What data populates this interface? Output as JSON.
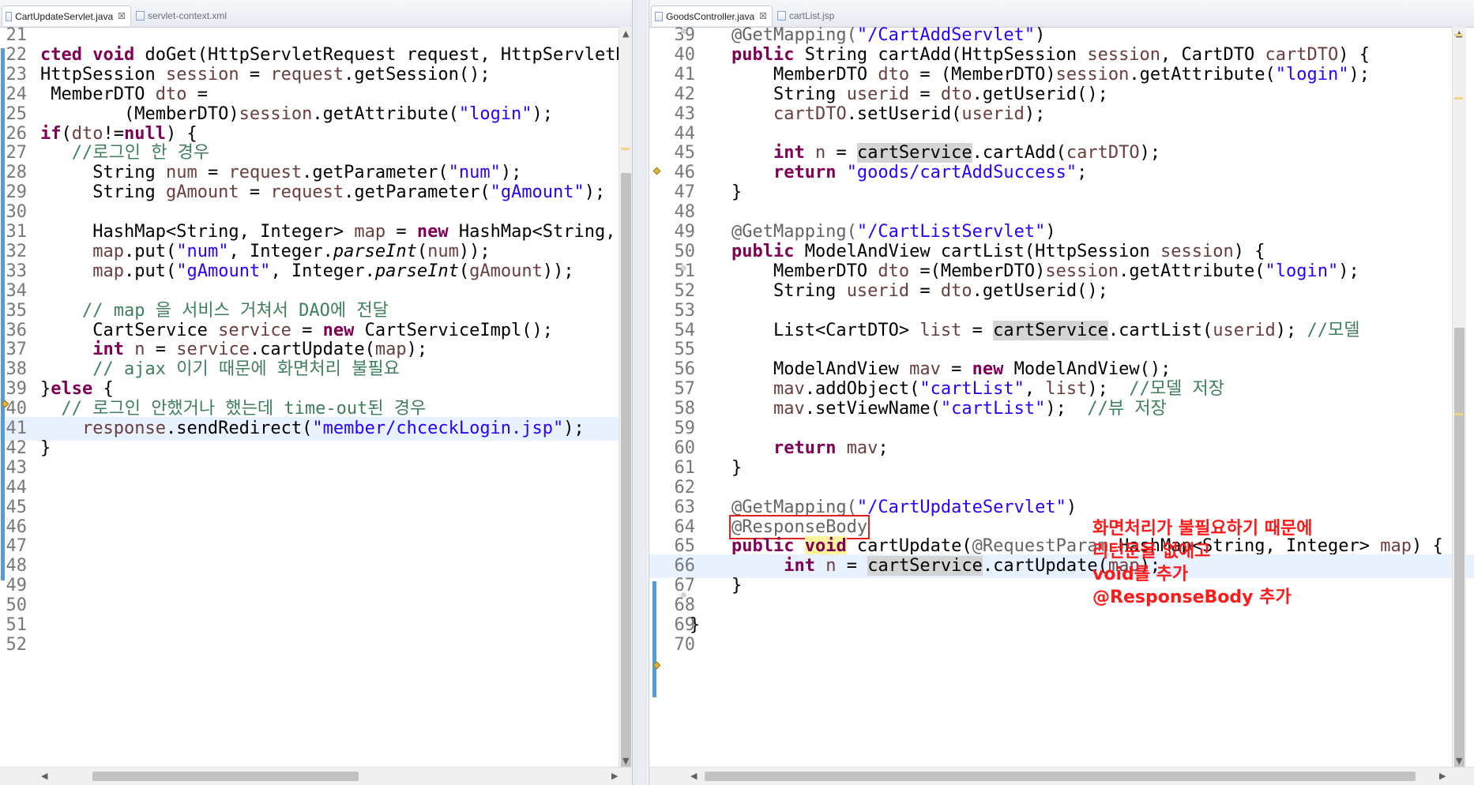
{
  "left_tabs": [
    {
      "label": "CartUpdateServlet.java",
      "active": true,
      "close": "☒"
    },
    {
      "label": "servlet-context.xml",
      "active": false
    }
  ],
  "right_tabs": [
    {
      "label": "GoodsController.java",
      "active": true,
      "close": "☒"
    },
    {
      "label": "cartList.jsp",
      "active": false
    }
  ],
  "left_lines": [
    {
      "n": "21",
      "t": []
    },
    {
      "n": "22",
      "t": [
        [
          "cted ",
          "kw"
        ],
        [
          "void ",
          "kw"
        ],
        [
          "doGet(HttpServletRequest ",
          ""
        ],
        [
          "request",
          ""
        ],
        [
          ", HttpServletRes",
          ""
        ]
      ]
    },
    {
      "n": "23",
      "t": [
        [
          "HttpSession ",
          ""
        ],
        [
          "session",
          "var"
        ],
        [
          " = ",
          ""
        ],
        [
          "request",
          "var"
        ],
        [
          ".getSession();",
          ""
        ]
      ]
    },
    {
      "n": "24",
      "t": [
        [
          " MemberDTO ",
          ""
        ],
        [
          "dto",
          "var"
        ],
        [
          " =",
          ""
        ]
      ]
    },
    {
      "n": "25",
      "t": [
        [
          "        (MemberDTO)",
          ""
        ],
        [
          "session",
          "var"
        ],
        [
          ".getAttribute(",
          ""
        ],
        [
          "\"login\"",
          "str"
        ],
        [
          ");",
          ""
        ]
      ]
    },
    {
      "n": "26",
      "t": [
        [
          "if",
          "kw"
        ],
        [
          "(",
          ""
        ],
        [
          "dto",
          "var"
        ],
        [
          "!=",
          ""
        ],
        [
          "null",
          "kw"
        ],
        [
          ") {",
          ""
        ]
      ]
    },
    {
      "n": "27",
      "t": [
        [
          "   //로그인 한 경우",
          "cm"
        ]
      ]
    },
    {
      "n": "28",
      "t": [
        [
          "     String ",
          ""
        ],
        [
          "num",
          "var"
        ],
        [
          " = ",
          ""
        ],
        [
          "request",
          "var"
        ],
        [
          ".getParameter(",
          ""
        ],
        [
          "\"num\"",
          "str"
        ],
        [
          ");",
          ""
        ]
      ]
    },
    {
      "n": "29",
      "t": [
        [
          "     String ",
          ""
        ],
        [
          "gAmount",
          "var"
        ],
        [
          " = ",
          ""
        ],
        [
          "request",
          "var"
        ],
        [
          ".getParameter(",
          ""
        ],
        [
          "\"gAmount\"",
          "str"
        ],
        [
          ");",
          ""
        ]
      ]
    },
    {
      "n": "30",
      "t": []
    },
    {
      "n": "31",
      "t": [
        [
          "     HashMap<String, Integer> ",
          ""
        ],
        [
          "map",
          "var"
        ],
        [
          " = ",
          ""
        ],
        [
          "new ",
          "kw"
        ],
        [
          "HashMap<String, In",
          ""
        ]
      ]
    },
    {
      "n": "32",
      "t": [
        [
          "     ",
          ""
        ],
        [
          "map",
          "var"
        ],
        [
          ".put(",
          ""
        ],
        [
          "\"num\"",
          "str"
        ],
        [
          ", Integer.",
          ""
        ],
        [
          "parseInt",
          "it"
        ],
        [
          "(",
          ""
        ],
        [
          "num",
          "var"
        ],
        [
          "));",
          ""
        ]
      ]
    },
    {
      "n": "33",
      "t": [
        [
          "     ",
          ""
        ],
        [
          "map",
          "var"
        ],
        [
          ".put(",
          ""
        ],
        [
          "\"gAmount\"",
          "str"
        ],
        [
          ", Integer.",
          ""
        ],
        [
          "parseInt",
          "it"
        ],
        [
          "(",
          ""
        ],
        [
          "gAmount",
          "var"
        ],
        [
          "));",
          ""
        ]
      ]
    },
    {
      "n": "34",
      "t": []
    },
    {
      "n": "35",
      "t": [
        [
          "    // map 을 서비스 거쳐서 DAO에 전달",
          "cm"
        ]
      ]
    },
    {
      "n": "36",
      "t": [
        [
          "     CartService ",
          ""
        ],
        [
          "service",
          "var"
        ],
        [
          " = ",
          ""
        ],
        [
          "new ",
          "kw"
        ],
        [
          "CartServiceImpl();",
          ""
        ]
      ]
    },
    {
      "n": "37",
      "t": [
        [
          "     ",
          ""
        ],
        [
          "int ",
          "kw"
        ],
        [
          "n",
          "var"
        ],
        [
          " = ",
          ""
        ],
        [
          "service",
          "var"
        ],
        [
          ".cartUpdate(",
          ""
        ],
        [
          "map",
          "var"
        ],
        [
          ");",
          ""
        ]
      ]
    },
    {
      "n": "38",
      "t": [
        [
          "     // ",
          "cm"
        ],
        [
          "ajax",
          "cm"
        ],
        [
          " 이기 때문에 화면처리 불필요",
          "cm"
        ]
      ]
    },
    {
      "n": "39",
      "t": [
        [
          "}",
          ""
        ],
        [
          "else",
          "kw"
        ],
        [
          " {",
          ""
        ]
      ]
    },
    {
      "n": "40",
      "t": [
        [
          "  // 로그인 안했거나 했는데 time-out된 경우",
          "cm"
        ]
      ]
    },
    {
      "n": "41",
      "t": [
        [
          "    ",
          ""
        ],
        [
          "response",
          "var"
        ],
        [
          ".sendRedirect(",
          ""
        ],
        [
          "\"member/chceckLogin.jsp\"",
          "str"
        ],
        [
          ");",
          ""
        ]
      ]
    },
    {
      "n": "42",
      "t": [
        [
          "}",
          ""
        ]
      ]
    },
    {
      "n": "43",
      "t": []
    },
    {
      "n": "44",
      "t": []
    },
    {
      "n": "45",
      "t": []
    },
    {
      "n": "46",
      "t": []
    },
    {
      "n": "47",
      "t": []
    },
    {
      "n": "48",
      "t": []
    },
    {
      "n": "49",
      "t": []
    },
    {
      "n": "50",
      "t": []
    },
    {
      "n": "51",
      "t": []
    },
    {
      "n": "52",
      "t": []
    }
  ],
  "right_lines": [
    {
      "n": "39",
      "t": [
        [
          "    @GetMapping(",
          "ann"
        ],
        [
          "\"/CartAddServlet\"",
          "str"
        ],
        [
          ")",
          ""
        ]
      ]
    },
    {
      "n": "40",
      "t": [
        [
          "    ",
          ""
        ],
        [
          "public ",
          "kw"
        ],
        [
          "String cartAdd(HttpSession ",
          ""
        ],
        [
          "session",
          "var"
        ],
        [
          ", CartDTO ",
          ""
        ],
        [
          "cartDTO",
          "var"
        ],
        [
          ") {",
          ""
        ]
      ]
    },
    {
      "n": "41",
      "t": [
        [
          "        MemberDTO ",
          ""
        ],
        [
          "dto",
          "var"
        ],
        [
          " = (MemberDTO)",
          ""
        ],
        [
          "session",
          "var"
        ],
        [
          ".getAttribute(",
          ""
        ],
        [
          "\"login\"",
          "str"
        ],
        [
          ");",
          ""
        ]
      ]
    },
    {
      "n": "42",
      "t": [
        [
          "        String ",
          ""
        ],
        [
          "userid",
          "var"
        ],
        [
          " = ",
          ""
        ],
        [
          "dto",
          "var"
        ],
        [
          ".getUserid();",
          ""
        ]
      ]
    },
    {
      "n": "43",
      "t": [
        [
          "        ",
          ""
        ],
        [
          "cartDTO",
          "var"
        ],
        [
          ".setUserid(",
          ""
        ],
        [
          "userid",
          "var"
        ],
        [
          ");",
          ""
        ]
      ]
    },
    {
      "n": "44",
      "t": []
    },
    {
      "n": "45",
      "t": [
        [
          "        ",
          ""
        ],
        [
          "int ",
          "kw"
        ],
        [
          "n",
          "var"
        ],
        [
          " = ",
          ""
        ],
        [
          "cartService",
          "occ"
        ],
        [
          ".cartAdd(",
          ""
        ],
        [
          "cartDTO",
          "var"
        ],
        [
          ");",
          ""
        ]
      ]
    },
    {
      "n": "46",
      "t": [
        [
          "        ",
          ""
        ],
        [
          "return ",
          "kw"
        ],
        [
          "\"goods/cartAddSuccess\"",
          "str"
        ],
        [
          ";",
          ""
        ]
      ]
    },
    {
      "n": "47",
      "t": [
        [
          "    }",
          ""
        ]
      ]
    },
    {
      "n": "48",
      "t": []
    },
    {
      "n": "49",
      "t": [
        [
          "    @GetMapping(",
          "ann"
        ],
        [
          "\"/CartListServlet\"",
          "str"
        ],
        [
          ")",
          ""
        ]
      ]
    },
    {
      "n": "50",
      "t": [
        [
          "    ",
          ""
        ],
        [
          "public ",
          "kw"
        ],
        [
          "ModelAndView cartList(HttpSession ",
          ""
        ],
        [
          "session",
          "var"
        ],
        [
          ") {",
          ""
        ]
      ]
    },
    {
      "n": "51",
      "t": [
        [
          "        MemberDTO ",
          ""
        ],
        [
          "dto",
          "var"
        ],
        [
          " =(MemberDTO)",
          ""
        ],
        [
          "session",
          "var"
        ],
        [
          ".getAttribute(",
          ""
        ],
        [
          "\"login\"",
          "str"
        ],
        [
          ");",
          ""
        ]
      ]
    },
    {
      "n": "52",
      "t": [
        [
          "        String ",
          ""
        ],
        [
          "userid",
          "var"
        ],
        [
          " = ",
          ""
        ],
        [
          "dto",
          "var"
        ],
        [
          ".getUserid();",
          ""
        ]
      ]
    },
    {
      "n": "53",
      "t": []
    },
    {
      "n": "54",
      "t": [
        [
          "        List<CartDTO> ",
          ""
        ],
        [
          "list",
          "var"
        ],
        [
          " = ",
          ""
        ],
        [
          "cartService",
          "occ"
        ],
        [
          ".cartList(",
          ""
        ],
        [
          "userid",
          "var"
        ],
        [
          "); ",
          ""
        ],
        [
          "//모델",
          "cm"
        ]
      ]
    },
    {
      "n": "55",
      "t": []
    },
    {
      "n": "56",
      "t": [
        [
          "        ModelAndView ",
          ""
        ],
        [
          "mav",
          "var"
        ],
        [
          " = ",
          ""
        ],
        [
          "new ",
          "kw"
        ],
        [
          "ModelAndView();",
          ""
        ]
      ]
    },
    {
      "n": "57",
      "t": [
        [
          "        ",
          ""
        ],
        [
          "mav",
          "var"
        ],
        [
          ".addObject(",
          ""
        ],
        [
          "\"cartList\"",
          "str"
        ],
        [
          ", ",
          ""
        ],
        [
          "list",
          "var"
        ],
        [
          ");  ",
          ""
        ],
        [
          "//모델 저장",
          "cm"
        ]
      ]
    },
    {
      "n": "58",
      "t": [
        [
          "        ",
          ""
        ],
        [
          "mav",
          "var"
        ],
        [
          ".setViewName(",
          ""
        ],
        [
          "\"cartList\"",
          "str"
        ],
        [
          ");  ",
          ""
        ],
        [
          "//뷰 저장",
          "cm"
        ]
      ]
    },
    {
      "n": "59",
      "t": []
    },
    {
      "n": "60",
      "t": [
        [
          "        ",
          ""
        ],
        [
          "return ",
          "kw"
        ],
        [
          "mav",
          "var"
        ],
        [
          ";",
          ""
        ]
      ]
    },
    {
      "n": "61",
      "t": [
        [
          "    }",
          ""
        ]
      ]
    },
    {
      "n": "62",
      "t": []
    },
    {
      "n": "63",
      "t": [
        [
          "    @GetMapping(",
          "ann"
        ],
        [
          "\"/CartUpdateServlet\"",
          "str"
        ],
        [
          ")",
          ""
        ]
      ]
    },
    {
      "n": "64",
      "t": [
        [
          "    ",
          ""
        ],
        [
          "@ResponseBody",
          "annbox"
        ]
      ]
    },
    {
      "n": "65",
      "t": [
        [
          "    ",
          ""
        ],
        [
          "public ",
          "kw"
        ],
        [
          "void",
          "kwyel"
        ],
        [
          " cartUpdate(",
          ""
        ],
        [
          "@RequestParam",
          "ann"
        ],
        [
          " HashMap<String, Integer> ",
          ""
        ],
        [
          "map",
          "var"
        ],
        [
          ") {",
          ""
        ]
      ]
    },
    {
      "n": "66",
      "t": [
        [
          "         ",
          ""
        ],
        [
          "int ",
          "kw"
        ],
        [
          "n",
          "var"
        ],
        [
          " = ",
          ""
        ],
        [
          "cartService",
          "occ"
        ],
        [
          ".cartUpdate(",
          ""
        ],
        [
          "map",
          "var"
        ],
        [
          ");",
          ""
        ]
      ]
    },
    {
      "n": "67",
      "t": [
        [
          "    }",
          ""
        ]
      ]
    },
    {
      "n": "68",
      "t": []
    },
    {
      "n": "69",
      "t": [
        [
          "}",
          ""
        ]
      ]
    },
    {
      "n": "70",
      "t": []
    }
  ],
  "note": [
    "화면처리가 불필요하기 때문에",
    "리턴문을 없애고",
    "void를 추가",
    "@ResponseBody 추가"
  ],
  "colors": {
    "keyword": "#7f0055",
    "string": "#2a00ff",
    "variable": "#6a3e3e",
    "comment": "#3f7f5f",
    "annotation": "#646464",
    "note": "#ff1a1a",
    "highlight_line": "#e8f2fe"
  }
}
